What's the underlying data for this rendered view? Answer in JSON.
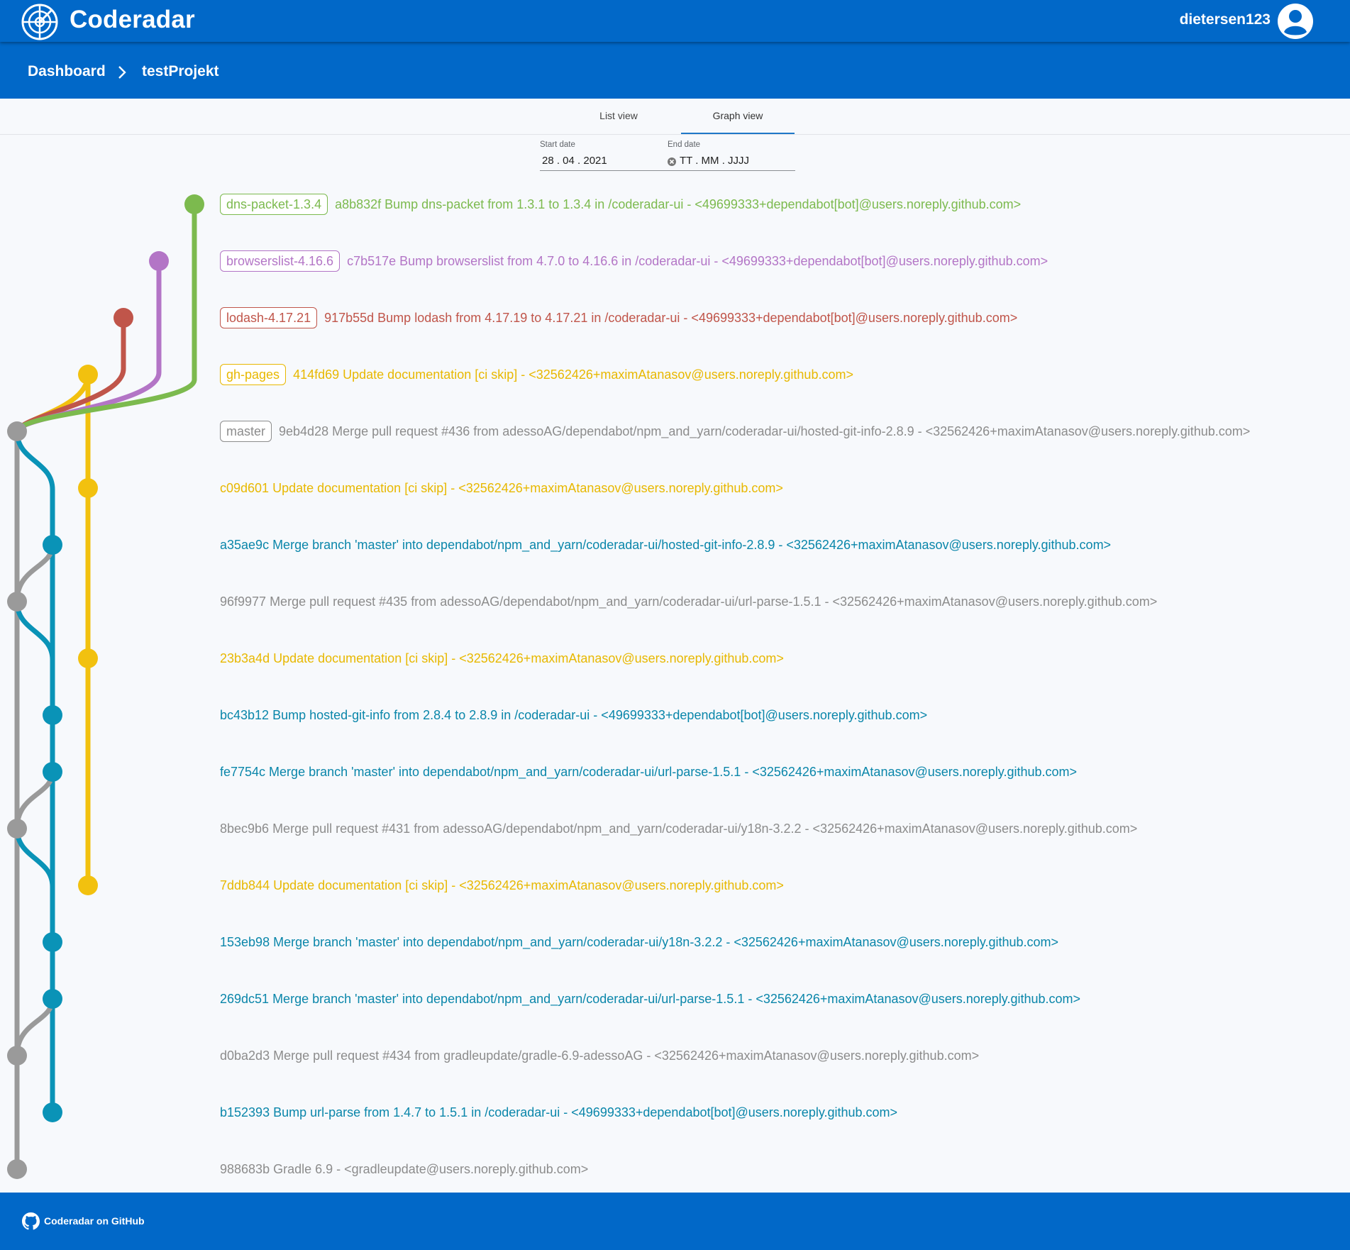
{
  "header": {
    "app_title": "Coderadar",
    "username": "dietersen123",
    "logo_icon": "radar-logo-icon",
    "avatar_icon": "account-circle-icon"
  },
  "breadcrumb": {
    "dashboard_label": "Dashboard",
    "separator_icon": "chevron-right-icon",
    "project_label": "testProjekt"
  },
  "tabs": [
    {
      "label": "List view",
      "active": false
    },
    {
      "label": "Graph view",
      "active": true
    }
  ],
  "filters": {
    "start_label": "Start date",
    "start_value": "28 . 04 . 2021",
    "end_label": "End date",
    "end_value": "TT . MM . JJJJ",
    "clear_icon": "clear-icon"
  },
  "colors": {
    "brand": "#0168c8",
    "branch_green": "#7cba4e",
    "branch_purple": "#b375c6",
    "branch_red": "#c0554a",
    "branch_yellow": "#f2c10f",
    "branch_gray": "#9a9a9a",
    "branch_teal": "#0a93b7"
  },
  "commits": [
    {
      "tag": "dns-packet-1.3.4",
      "text": "a8b832f Bump dns-packet from 1.3.1 to 1.3.4 in /coderadar-ui - <49699333+dependabot[bot]@users.noreply.github.com>",
      "color": "#7cba4e"
    },
    {
      "tag": "browserslist-4.16.6",
      "text": "c7b517e Bump browserslist from 4.7.0 to 4.16.6 in /coderadar-ui - <49699333+dependabot[bot]@users.noreply.github.com>",
      "color": "#b375c6"
    },
    {
      "tag": "lodash-4.17.21",
      "text": "917b55d Bump lodash from 4.17.19 to 4.17.21 in /coderadar-ui - <49699333+dependabot[bot]@users.noreply.github.com>",
      "color": "#c0554a"
    },
    {
      "tag": "gh-pages",
      "text": "414fd69 Update documentation [ci skip] - <32562426+maximAtanasov@users.noreply.github.com>",
      "color": "#e8b800"
    },
    {
      "tag": "master",
      "text": "9eb4d28 Merge pull request #436 from adessoAG/dependabot/npm_and_yarn/coderadar-ui/hosted-git-info-2.8.9 - <32562426+maximAtanasov@users.noreply.github.com>",
      "color": "#8c8c8c"
    },
    {
      "tag": null,
      "text": "c09d601 Update documentation [ci skip] - <32562426+maximAtanasov@users.noreply.github.com>",
      "color": "#e8b800"
    },
    {
      "tag": null,
      "text": "a35ae9c Merge branch 'master' into dependabot/npm_and_yarn/coderadar-ui/hosted-git-info-2.8.9 - <32562426+maximAtanasov@users.noreply.github.com>",
      "color": "#0a86aa"
    },
    {
      "tag": null,
      "text": "96f9977 Merge pull request #435 from adessoAG/dependabot/npm_and_yarn/coderadar-ui/url-parse-1.5.1 - <32562426+maximAtanasov@users.noreply.github.com>",
      "color": "#8c8c8c"
    },
    {
      "tag": null,
      "text": "23b3a4d Update documentation [ci skip] - <32562426+maximAtanasov@users.noreply.github.com>",
      "color": "#e8b800"
    },
    {
      "tag": null,
      "text": "bc43b12 Bump hosted-git-info from 2.8.4 to 2.8.9 in /coderadar-ui - <49699333+dependabot[bot]@users.noreply.github.com>",
      "color": "#0a86aa"
    },
    {
      "tag": null,
      "text": "fe7754c Merge branch 'master' into dependabot/npm_and_yarn/coderadar-ui/url-parse-1.5.1 - <32562426+maximAtanasov@users.noreply.github.com>",
      "color": "#0a86aa"
    },
    {
      "tag": null,
      "text": "8bec9b6 Merge pull request #431 from adessoAG/dependabot/npm_and_yarn/coderadar-ui/y18n-3.2.2 - <32562426+maximAtanasov@users.noreply.github.com>",
      "color": "#8c8c8c"
    },
    {
      "tag": null,
      "text": "7ddb844 Update documentation [ci skip] - <32562426+maximAtanasov@users.noreply.github.com>",
      "color": "#e8b800"
    },
    {
      "tag": null,
      "text": "153eb98 Merge branch 'master' into dependabot/npm_and_yarn/coderadar-ui/y18n-3.2.2 - <32562426+maximAtanasov@users.noreply.github.com>",
      "color": "#0a86aa"
    },
    {
      "tag": null,
      "text": "269dc51 Merge branch 'master' into dependabot/npm_and_yarn/coderadar-ui/url-parse-1.5.1 - <32562426+maximAtanasov@users.noreply.github.com>",
      "color": "#0a86aa"
    },
    {
      "tag": null,
      "text": "d0ba2d3 Merge pull request #434 from gradleupdate/gradle-6.9-adessoAG - <32562426+maximAtanasov@users.noreply.github.com>",
      "color": "#8c8c8c"
    },
    {
      "tag": null,
      "text": "b152393 Bump url-parse from 1.4.7 to 1.5.1 in /coderadar-ui - <49699333+dependabot[bot]@users.noreply.github.com>",
      "color": "#0a86aa"
    },
    {
      "tag": null,
      "text": "988683b Gradle 6.9 - <gradleupdate@users.noreply.github.com>",
      "color": "#8c8c8c"
    }
  ],
  "footer": {
    "github_label": "Coderadar on GitHub",
    "github_icon": "github-icon"
  }
}
